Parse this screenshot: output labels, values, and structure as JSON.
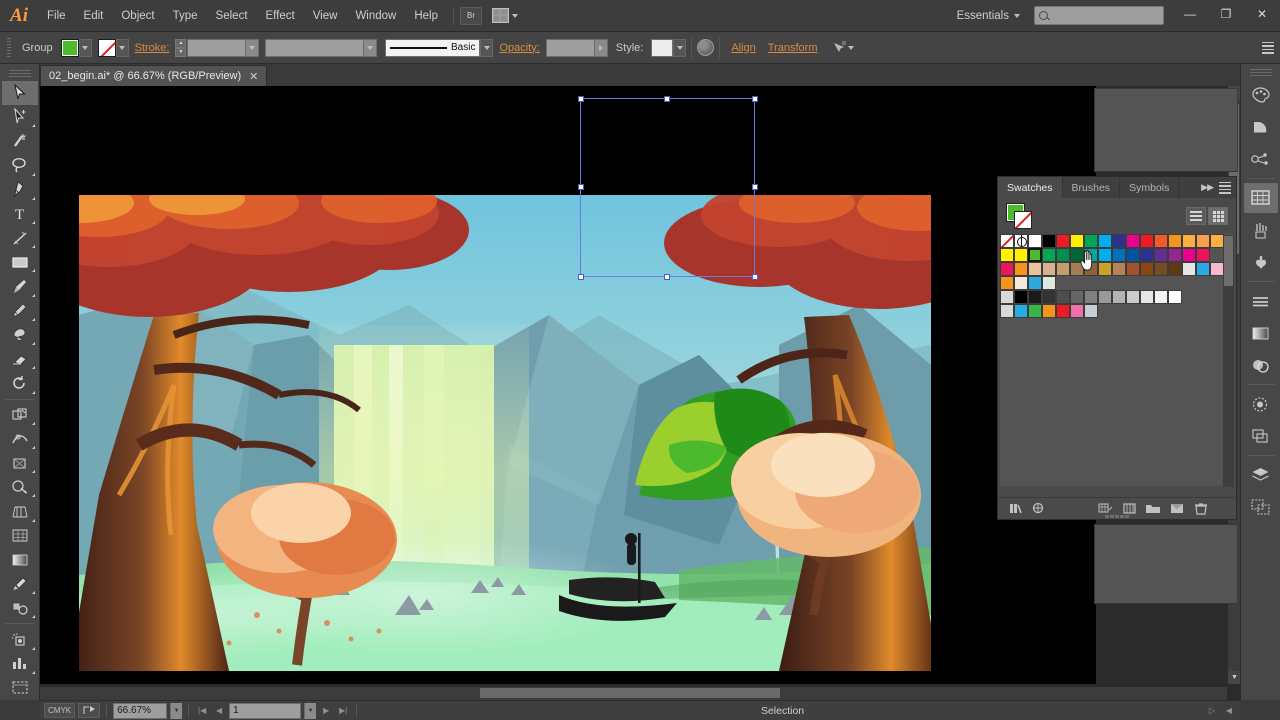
{
  "app": {
    "name": "Ai",
    "logo_color": "#ff9a3c"
  },
  "menubar": {
    "items": [
      "File",
      "Edit",
      "Object",
      "Type",
      "Select",
      "Effect",
      "View",
      "Window",
      "Help"
    ],
    "bridge_label": "Br",
    "workspace": "Essentials",
    "search_placeholder": "",
    "window_buttons": {
      "minimize": "—",
      "restore": "❐",
      "close": "✕"
    }
  },
  "controlbar": {
    "selection_label": "Group",
    "fill_color": "#4cbb2c",
    "stroke_label": "Stroke:",
    "stroke_weight": "",
    "stroke_profile": "",
    "brush_label": "Basic",
    "opacity_label": "Opacity:",
    "opacity_value": "",
    "style_label": "Style:",
    "align_label": "Align",
    "transform_label": "Transform"
  },
  "document": {
    "tab_title": "02_begin.ai* @ 66.67% (RGB/Preview)",
    "close_glyph": "✕"
  },
  "toolbar": {
    "tools": [
      {
        "name": "selection-tool",
        "active": true
      },
      {
        "name": "direct-selection-tool",
        "active": false
      },
      {
        "name": "magic-wand-tool",
        "active": false
      },
      {
        "name": "lasso-tool",
        "active": false
      },
      {
        "name": "pen-tool",
        "active": false
      },
      {
        "name": "type-tool",
        "active": false
      },
      {
        "name": "line-segment-tool",
        "active": false
      },
      {
        "name": "rectangle-tool",
        "active": false
      },
      {
        "name": "paintbrush-tool",
        "active": false
      },
      {
        "name": "pencil-tool",
        "active": false
      },
      {
        "name": "blob-brush-tool",
        "active": false
      },
      {
        "name": "eraser-tool",
        "active": false
      },
      {
        "name": "rotate-tool",
        "active": false
      },
      {
        "name": "scale-tool",
        "active": false
      },
      {
        "name": "width-tool",
        "active": false
      },
      {
        "name": "free-transform-tool",
        "active": false
      },
      {
        "name": "shape-builder-tool",
        "active": false
      },
      {
        "name": "perspective-grid-tool",
        "active": false
      },
      {
        "name": "mesh-tool",
        "active": false
      },
      {
        "name": "gradient-tool",
        "active": false
      },
      {
        "name": "eyedropper-tool",
        "active": false
      },
      {
        "name": "blend-tool",
        "active": false
      },
      {
        "name": "symbol-sprayer-tool",
        "active": false
      },
      {
        "name": "column-graph-tool",
        "active": false
      },
      {
        "name": "artboard-tool",
        "active": false
      }
    ]
  },
  "panel": {
    "tabs": [
      {
        "label": "Swatches",
        "active": true
      },
      {
        "label": "Brushes",
        "active": false
      },
      {
        "label": "Symbols",
        "active": false
      }
    ],
    "fill_color": "#4cbb2c",
    "stroke_none": true,
    "view_list": "list-view",
    "view_grid": "grid-view",
    "swatch_rows": [
      [
        "none",
        "reg",
        "#ffffff",
        "#000000",
        "#ed1c24",
        "#fff200",
        "#00a651",
        "#00aeef",
        "#2e3192",
        "#ec008c",
        "#ed1c24",
        "#f15a29",
        "#f7941e",
        "#fbb040",
        "#f9a04b",
        "#fbb040"
      ],
      [
        "#fff200",
        "#fff200",
        "#4cbb2c",
        "#00a651",
        "#008f4c",
        "#006838",
        "#00a99d",
        "#00aeef",
        "#0072bc",
        "#0054a6",
        "#2e3192",
        "#662d91",
        "#92278f",
        "#ec008c",
        "#ed145b"
      ],
      [
        "#ed145b",
        "#f7941e",
        "#e8c39e",
        "#d9b08c",
        "#c69c6d",
        "#a67c52",
        "#8c6239",
        "#c9a227",
        "#b5835a",
        "#a0522d",
        "#8b4513",
        "#754c24",
        "#603813",
        "#e6e6e6",
        "#29abe2",
        "#f6b8cb"
      ],
      [
        "#f7941e",
        "#f2e8dc",
        "#29abe2",
        "#dfe8df"
      ],
      [
        "#d9d9d9",
        "#000000",
        "#1a1a1a",
        "#333333",
        "#4d4d4d",
        "#666666",
        "#808080",
        "#999999",
        "#b3b3b3",
        "#cccccc",
        "#e6e6e6",
        "#f2f2f2",
        "#ffffff"
      ],
      [
        "#d9d9d9",
        "#29abe2",
        "#39b54a",
        "#f7941e",
        "#ed1c24",
        "#f06eaa",
        "#c7ced4"
      ]
    ],
    "selected_swatch": {
      "row": 1,
      "index": 2,
      "color": "#4cbb2c"
    },
    "footer_buttons": [
      "swatch-libraries-menu-icon",
      "show-swatch-kinds-menu-icon",
      "swatch-options-icon",
      "new-color-group-icon",
      "new-swatch-icon",
      "delete-swatch-icon"
    ]
  },
  "right_dock": {
    "buttons": [
      "color-panel-icon",
      "color-guide-icon",
      "kuler-icon",
      "swatches-panel-icon",
      "brushes-panel-icon",
      "symbols-panel-icon",
      "stroke-panel-icon",
      "gradient-panel-icon",
      "transparency-panel-icon",
      "appearance-panel-icon",
      "graphic-styles-panel-icon",
      "layers-panel-icon",
      "artboards-panel-icon"
    ],
    "active": "swatches-panel-icon"
  },
  "statusbar": {
    "cmyk_label": "CMYK",
    "zoom_level": "66.67%",
    "page_number": "1",
    "status_text": "Selection"
  },
  "canvas": {
    "selection_tool_name": "selection-bounding-box",
    "artwork_title": "forest-waterfall-illustration",
    "palette": {
      "sky": "#7ec8d8",
      "cliff": "#6f9fa8",
      "ground": "#9fe3b0",
      "tree_red": "#a8352c",
      "tree_orange": "#e0622c",
      "tree_green": "#3faa28",
      "tree_green_light": "#9bcf2e",
      "trunk": "#8a4f2a",
      "trunk_dark": "#4a2418",
      "blossom": "#f6c79a"
    }
  }
}
